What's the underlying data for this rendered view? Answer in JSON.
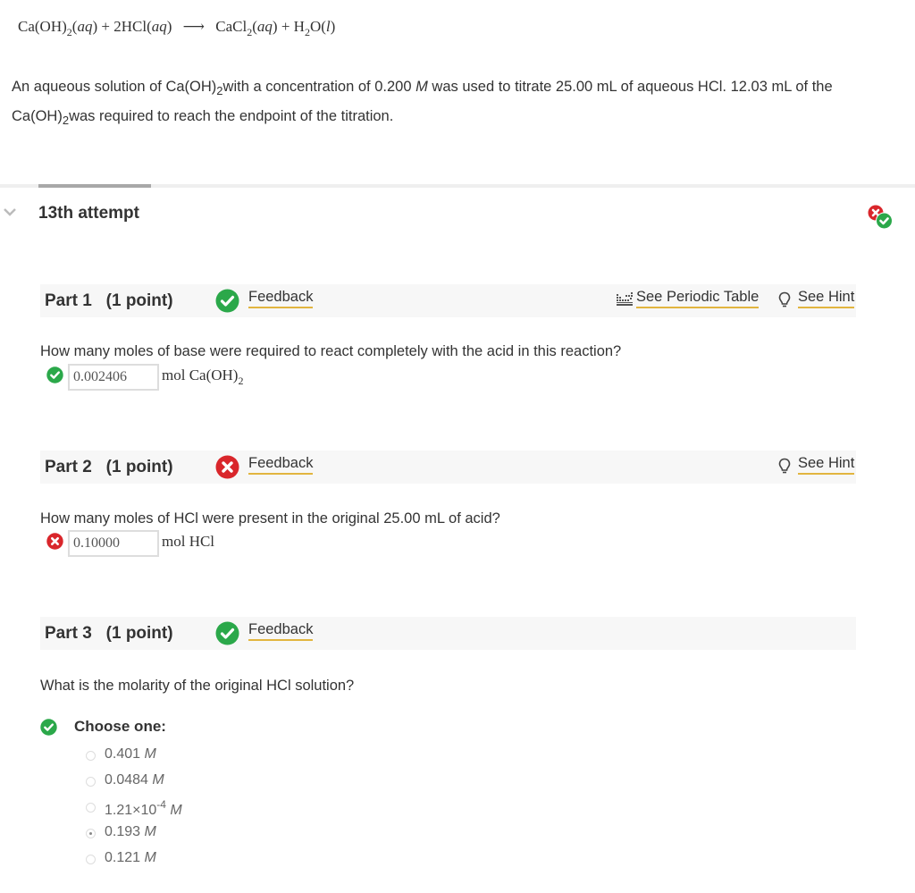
{
  "equation": {
    "reactant1": "Ca",
    "reactant1_group": "(OH)",
    "reactant1_sub": "2",
    "state_aq": "aq",
    "plus": "+",
    "reactant2": "2HCl",
    "product1": "CaCl",
    "product1_sub": "2",
    "product2_a": "H",
    "product2_sub": "2",
    "product2_b": "O",
    "state_l": "l"
  },
  "problem": {
    "part1": "An aqueous solution of Ca(OH)",
    "sub": "2",
    "part2": "with a concentration of 0.200 ",
    "unit_M": "M",
    "part3": " was used to titrate 25.00 mL of aqueous HCl. 12.03 mL of the Ca(OH)",
    "part4": "was required to reach the endpoint of the titration."
  },
  "attempt": {
    "title": "13th attempt",
    "status": "mixed"
  },
  "colors": {
    "correct": "#2ba84a",
    "incorrect": "#d9262b",
    "link_underline": "#e2b53f",
    "header_bg": "#f7f7f7"
  },
  "links": {
    "feedback": "Feedback",
    "periodic_table": "See Periodic Table",
    "hint": "See Hint"
  },
  "parts": [
    {
      "title": "Part 1   (1 point)",
      "status": "correct",
      "question": "How many moles of base were required to react completely with the acid in this reaction?",
      "answer_value": "0.002406",
      "answer_status": "correct",
      "unit": "mol Ca(OH)",
      "unit_sub": "2"
    },
    {
      "title": "Part 2   (1 point)",
      "status": "incorrect",
      "question": "How many moles of HCl were present in the original 25.00 mL of acid?",
      "answer_value": "0.10000",
      "answer_status": "incorrect",
      "unit": "mol HCl"
    },
    {
      "title": "Part 3   (1 point)",
      "status": "correct",
      "question": "What is the molarity of the original HCl solution?",
      "choose_label": "Choose one:",
      "options": [
        {
          "value": "0.401",
          "unit": "M",
          "selected": false
        },
        {
          "value": "0.0484",
          "unit": "M",
          "selected": false
        },
        {
          "value": "1.21×10",
          "exp": "-4",
          "unit": "M",
          "selected": false
        },
        {
          "value": "0.193",
          "unit": "M",
          "selected": true
        },
        {
          "value": "0.121",
          "unit": "M",
          "selected": false
        }
      ]
    }
  ]
}
